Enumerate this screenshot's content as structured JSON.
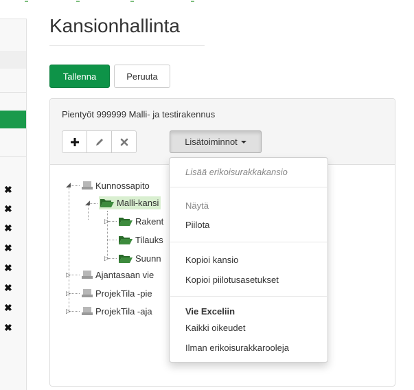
{
  "page": {
    "title": "Kansionhallinta"
  },
  "actions": {
    "save_label": "Tallenna",
    "cancel_label": "Peruuta"
  },
  "panel": {
    "project_name": "Pientyöt 999999 Malli- ja testirakennus",
    "toolbar": {
      "add_icon": "plus-icon",
      "edit_icon": "pencil-icon",
      "delete_icon": "x-icon",
      "more_label": "Lisätoiminnot"
    }
  },
  "tree": {
    "nodes": [
      {
        "label": "Kunnossapito",
        "icon": "drive-icon"
      },
      {
        "label": "Malli-kansi",
        "icon": "folder-open-icon",
        "selected": true
      },
      {
        "label": "Rakent",
        "icon": "folder-open-icon"
      },
      {
        "label": "Tilauks",
        "icon": "folder-open-icon"
      },
      {
        "label": "Suunn",
        "icon": "folder-open-icon"
      },
      {
        "label": "Ajantasaan vie",
        "icon": "drive-icon"
      },
      {
        "label": "ProjekTila -pie",
        "icon": "drive-icon"
      },
      {
        "label": "ProjekTila -aja",
        "icon": "drive-icon"
      }
    ]
  },
  "menu": {
    "add_special": "Lisää erikoisurakkakansio",
    "show_header": "Näytä",
    "hide": "Piilota",
    "copy_folder": "Kopioi kansio",
    "copy_hide_settings": "Kopioi piilotusasetukset",
    "excel_header": "Vie Exceliin",
    "all_rights": "Kaikki oikeudet",
    "without_special_roles": "Ilman erikoisurakkarooleja"
  },
  "colors": {
    "primary_green": "#0e9348",
    "selected_node": "#d9efd0",
    "folder_green": "#1f6b1f"
  }
}
